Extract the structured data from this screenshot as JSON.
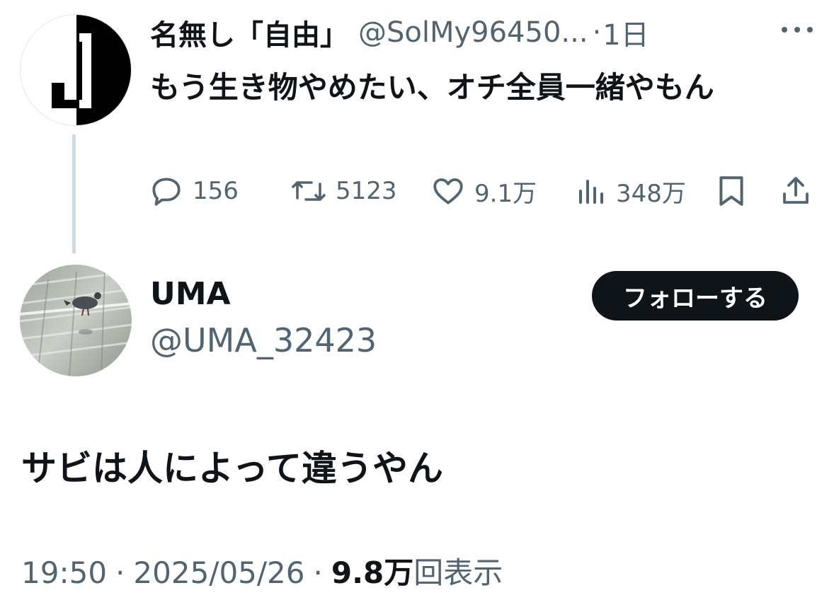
{
  "parent_tweet": {
    "display_name": "名無し「自由」",
    "handle": "@SolMy96450...",
    "separator": "·",
    "time": "1日",
    "text": "もう生き物やめたい、オチ全員一緒やもん",
    "actions": {
      "replies": "156",
      "reposts": "5123",
      "likes": "9.1万",
      "views": "348万"
    },
    "icons": [
      "reply-icon",
      "repost-icon",
      "like-icon",
      "views-icon",
      "bookmark-icon",
      "share-icon",
      "more-icon"
    ]
  },
  "reply_tweet": {
    "display_name": "UMA",
    "handle": "@UMA_32423",
    "follow_label": "フォローする",
    "text": "サビは人によって違うやん",
    "meta": {
      "time": "19:50",
      "sep1": "·",
      "date": "2025/05/26",
      "sep2": "·",
      "views_count": "9.8万",
      "views_suffix": "回表示"
    }
  },
  "colors": {
    "text": "#0f1419",
    "secondary": "#536471",
    "thread_line": "#cfd9de",
    "button_bg": "#0f1419",
    "button_text": "#ffffff"
  }
}
